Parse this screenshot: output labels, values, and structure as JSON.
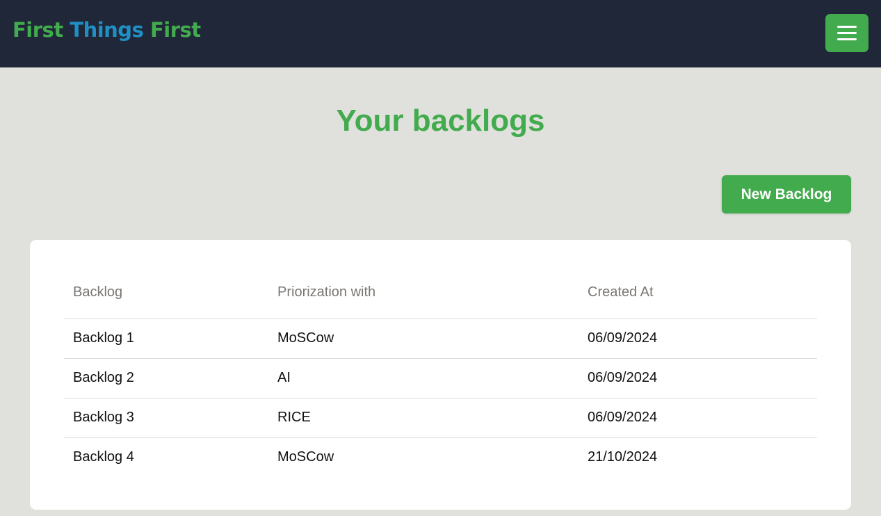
{
  "navbar": {
    "brand": {
      "word1": "First",
      "word2": "Things",
      "word3": "First"
    },
    "menu_icon": "hamburger-menu-icon"
  },
  "main": {
    "title": "Your backlogs",
    "new_backlog_label": "New Backlog"
  },
  "table": {
    "headers": [
      "Backlog",
      "Priorization with",
      "Created At"
    ],
    "rows": [
      {
        "name": "Backlog 1",
        "prioritization": "MoSCow",
        "created_at": "06/09/2024"
      },
      {
        "name": "Backlog 2",
        "prioritization": "AI",
        "created_at": "06/09/2024"
      },
      {
        "name": "Backlog 3",
        "prioritization": "RICE",
        "created_at": "06/09/2024"
      },
      {
        "name": "Backlog 4",
        "prioritization": "MoSCow",
        "created_at": "21/10/2024"
      }
    ]
  },
  "colors": {
    "navbar_bg": "#1f2739",
    "accent_green": "#42ab4d",
    "accent_blue": "#1f8fc4",
    "page_bg": "#e0e1dd",
    "card_bg": "#ffffff"
  }
}
